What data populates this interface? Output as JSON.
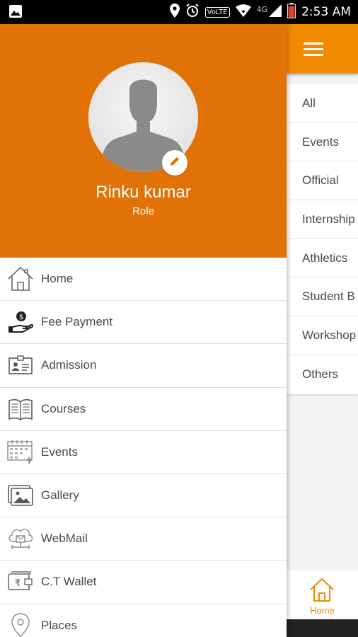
{
  "status_bar": {
    "time": "2:53 AM",
    "volte": "VoLTE",
    "network": "4G"
  },
  "main": {
    "categories": [
      "All",
      "Events",
      "Official",
      "Internship",
      "Athletics",
      "Student B",
      "Workshop",
      "Others"
    ],
    "bottom_nav": {
      "home_label": "Home"
    }
  },
  "drawer": {
    "user_name": "Rinku kumar",
    "user_role": "Role",
    "menu": [
      {
        "label": "Home",
        "icon": "home-icon"
      },
      {
        "label": "Fee Payment",
        "icon": "fee-payment-icon"
      },
      {
        "label": "Admission",
        "icon": "id-card-icon"
      },
      {
        "label": "Courses",
        "icon": "book-icon"
      },
      {
        "label": "Events",
        "icon": "calendar-icon"
      },
      {
        "label": "Gallery",
        "icon": "gallery-icon"
      },
      {
        "label": "WebMail",
        "icon": "cloud-mail-icon"
      },
      {
        "label": "C.T Wallet",
        "icon": "wallet-icon"
      },
      {
        "label": "Places",
        "icon": "location-pin-icon"
      }
    ]
  },
  "colors": {
    "header_orange": "#e07208",
    "appbar_orange": "#f28a00",
    "text_grey": "#4a4a4a"
  }
}
